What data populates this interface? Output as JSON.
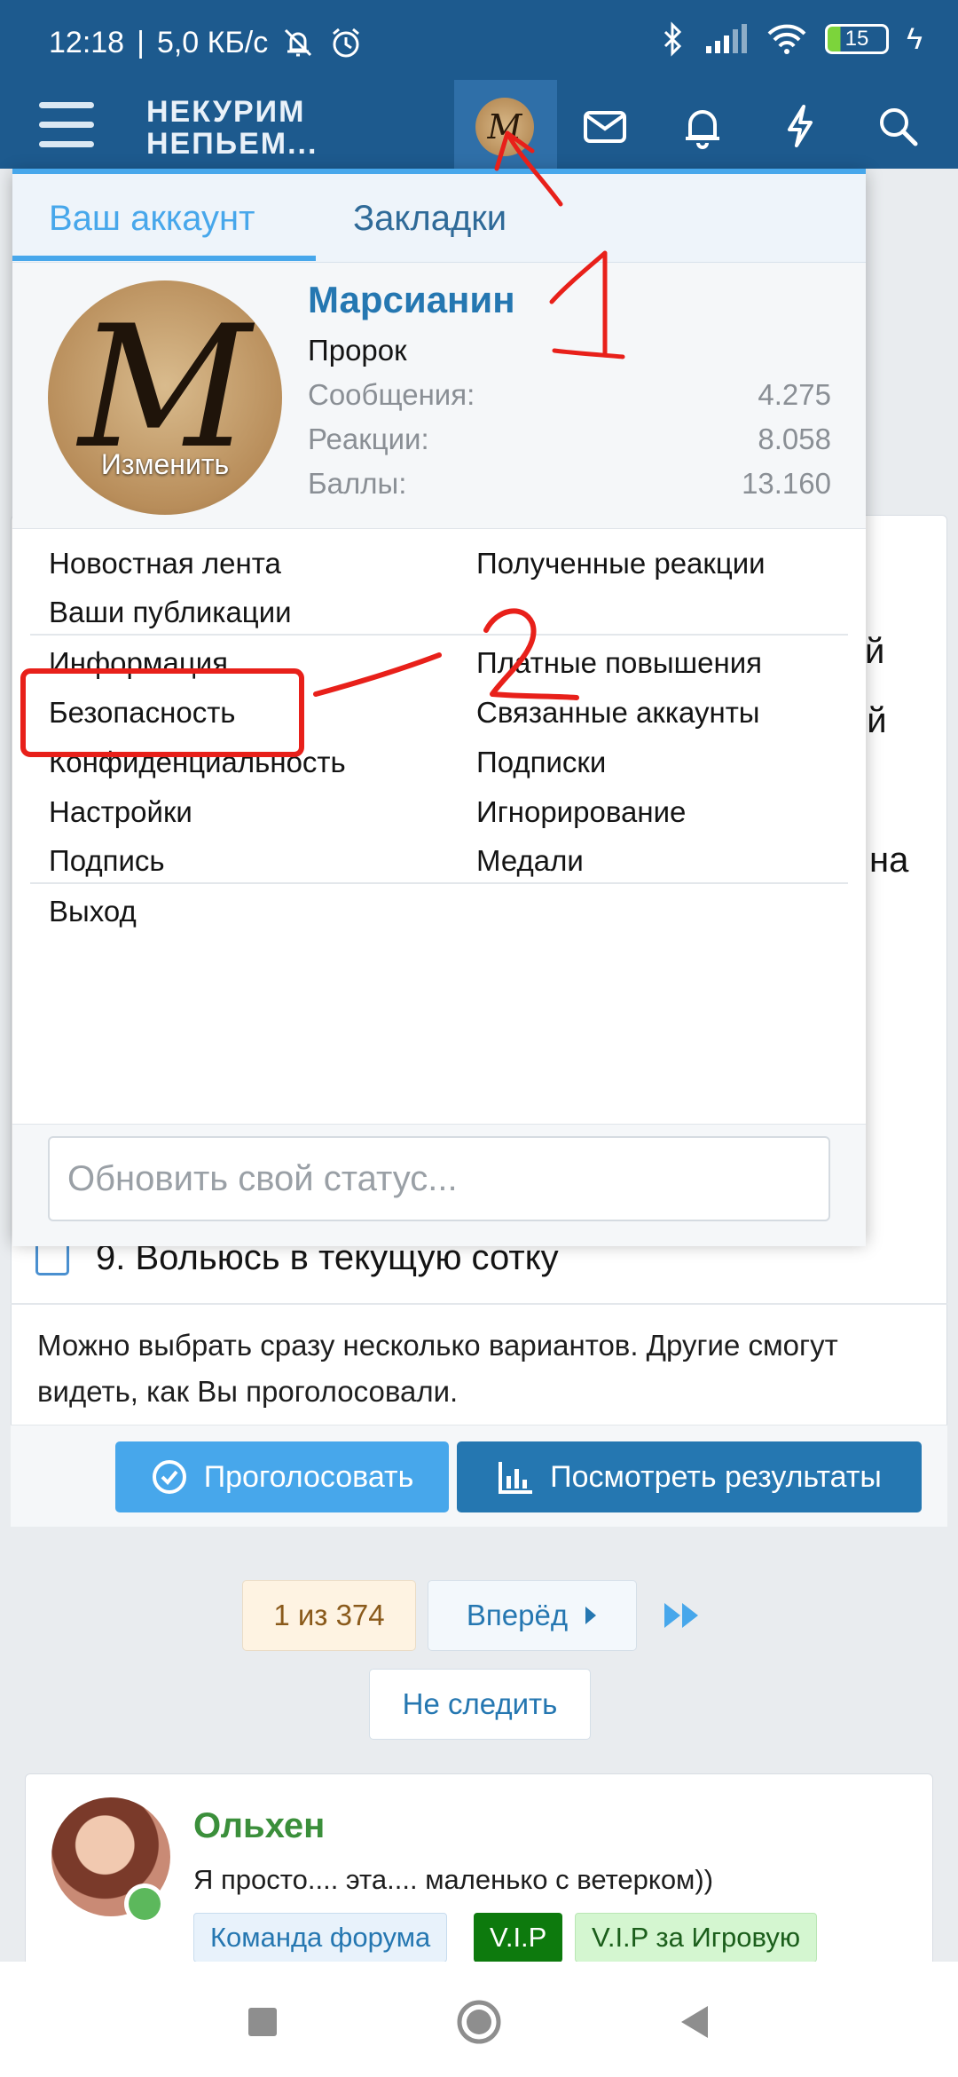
{
  "status_bar": {
    "time": "12:18",
    "speed": "5,0 КБ/с",
    "battery": "15"
  },
  "header": {
    "logo_line1": "НЕКУРИМ",
    "logo_line2": "НЕПЬЕМ...",
    "avatar_letter": "M"
  },
  "background": {
    "fragment_1": "й",
    "fragment_2": "ой",
    "fragment_3": "на",
    "poll_option": "9. Вольюсь в текущую сотку",
    "poll_note": "Можно выбрать сразу несколько вариантов. Другие смогут видеть, как Вы проголосовали.",
    "vote_label": "Проголосовать",
    "results_label": "Посмотреть результаты",
    "pager_current": "1 из 374",
    "pager_next": "Вперёд",
    "unfollow_label": "Не следить"
  },
  "post": {
    "author": "Ольхен",
    "status": "Я просто.... эта.... маленько с ветерком))",
    "badges": [
      "Команда форума",
      "V.I.P",
      "V.I.P за Игровую"
    ]
  },
  "dropdown": {
    "tabs": [
      "Ваш аккаунт",
      "Закладки"
    ],
    "avatar_letter": "M",
    "avatar_change": "Изменить",
    "username": "Марсианин",
    "user_title": "Пророк",
    "stats": [
      {
        "label": "Сообщения:",
        "value": "4.275"
      },
      {
        "label": "Реакции:",
        "value": "8.058"
      },
      {
        "label": "Баллы:",
        "value": "13.160"
      }
    ],
    "menu_left": [
      "Новостная лента",
      "Ваши публикации",
      "Информация",
      "Безопасность",
      "Конфиденциальность",
      "Настройки",
      "Подпись"
    ],
    "menu_right": [
      "Полученные реакции",
      "Платные повышения",
      "Связанные аккаунты",
      "Подписки",
      "Игнорирование",
      "Медали"
    ],
    "logout": "Выход",
    "status_placeholder": "Обновить свой статус..."
  },
  "colors": {
    "header": "#1d5a8e",
    "accent": "#47a7eb",
    "link": "#2577b1",
    "annotation": "#e8201a"
  }
}
